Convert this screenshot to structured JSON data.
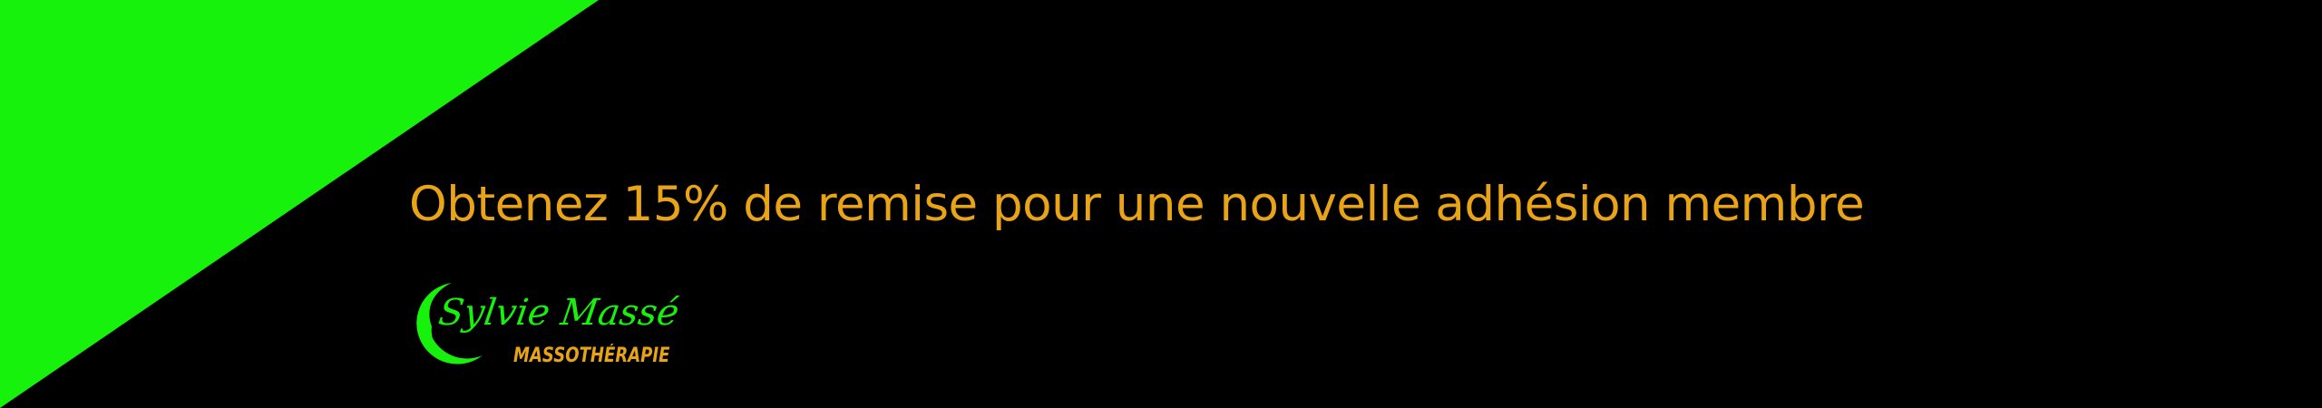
{
  "banner": {
    "promo_text": "Obtenez 15% de remise pour une nouvelle adhésion membre",
    "accent_color": "#16F20C",
    "text_color": "#E8A317",
    "background_color": "#000000"
  },
  "logo": {
    "name": "Sylvie Massé",
    "subtitle": "MASSOTHÉRAPIE",
    "icon": "green-crescent-ring-icon"
  }
}
